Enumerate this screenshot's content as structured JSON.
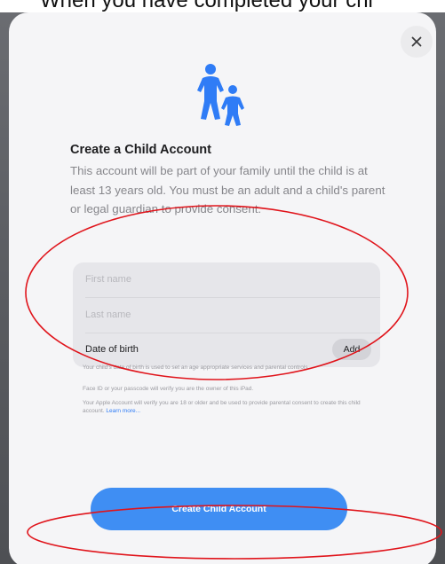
{
  "top_caption": "When you have completed your chi",
  "dialog": {
    "close_glyph": "×",
    "hero_icon": "parent-child-icon",
    "title": "Create a Child Account",
    "description": "This account will be part of your family until the child is at least 13 years old. You must be an adult and a child's parent or legal guardian to provide consent.",
    "form": {
      "first_name_placeholder": "First name",
      "last_name_placeholder": "Last name",
      "dob_label": "Date of birth",
      "add_label": "Add"
    },
    "notes": {
      "dob_note": "Your child's date of birth is used to set an age appropriate services and parental controls.",
      "faceid_note": "Face ID or your passcode will verify you are the owner of this iPad.",
      "account_note": "Your Apple Account will verify you are 18 or older and be used to provide parental consent to create this child account.",
      "learn_more": "Learn more..."
    },
    "primary_button": "Create Child Account"
  },
  "colors": {
    "accent": "#3f8ef3",
    "annotation": "#e0141b",
    "link": "#2f7cf6"
  }
}
